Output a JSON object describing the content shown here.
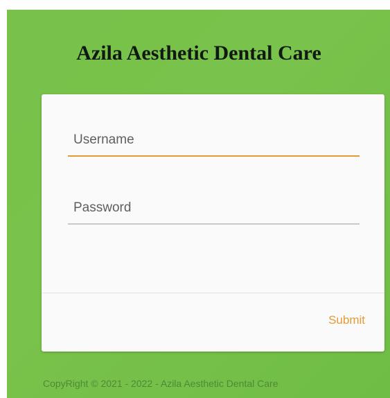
{
  "header": {
    "title": "Azila Aesthetic Dental Care"
  },
  "login_form": {
    "username": {
      "placeholder": "Username",
      "value": ""
    },
    "password": {
      "placeholder": "Password",
      "value": ""
    },
    "submit_label": "Submit"
  },
  "footer": {
    "copyright": "CopyRight © 2021 - 2022 - Azila Aesthetic Dental Care"
  },
  "colors": {
    "background_green": "#78c14a",
    "accent_orange": "#e39a33",
    "card_background": "#fafafa"
  }
}
